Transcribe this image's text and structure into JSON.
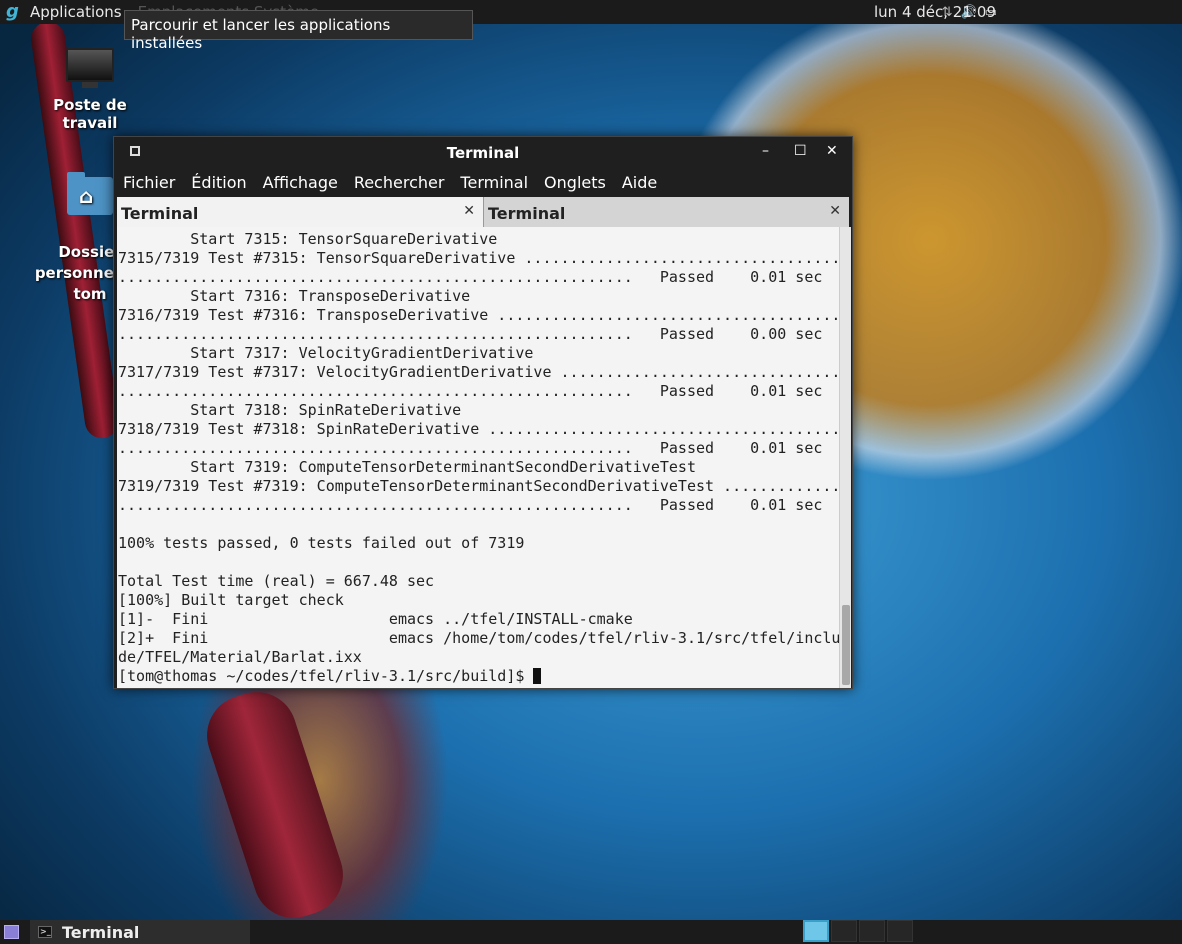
{
  "top_panel": {
    "applications_label": "Applications",
    "hidden_labels": "Emplacements  Système",
    "clock": "lun  4 déc, 21:09"
  },
  "tooltip": "Parcourir et lancer les applications installées",
  "desktop": {
    "icons": [
      {
        "label": "Poste de travail"
      },
      {
        "label": "Dossier\npersonnel de tom"
      }
    ]
  },
  "window": {
    "title": "Terminal",
    "menu": [
      "Fichier",
      "Édition",
      "Affichage",
      "Rechercher",
      "Terminal",
      "Onglets",
      "Aide"
    ],
    "tabs": [
      {
        "label": "Terminal",
        "active": true
      },
      {
        "label": "Terminal",
        "active": false
      }
    ],
    "terminal_lines": [
      "        Start 7315: TensorSquareDerivative",
      "7315/7319 Test #7315: TensorSquareDerivative ..............................................",
      ".........................................................   Passed    0.01 sec",
      "        Start 7316: TransposeDerivative",
      "7316/7319 Test #7316: TransposeDerivative ..................................................",
      ".........................................................   Passed    0.00 sec",
      "        Start 7317: VelocityGradientDerivative",
      "7317/7319 Test #7317: VelocityGradientDerivative ...........................................",
      ".........................................................   Passed    0.01 sec",
      "        Start 7318: SpinRateDerivative",
      "7318/7319 Test #7318: SpinRateDerivative ...................................................",
      ".........................................................   Passed    0.01 sec",
      "        Start 7319: ComputeTensorDeterminantSecondDerivativeTest",
      "7319/7319 Test #7319: ComputeTensorDeterminantSecondDerivativeTest ..........................",
      ".........................................................   Passed    0.01 sec",
      "",
      "100% tests passed, 0 tests failed out of 7319",
      "",
      "Total Test time (real) = 667.48 sec",
      "[100%] Built target check",
      "[1]-  Fini                    emacs ../tfel/INSTALL-cmake",
      "[2]+  Fini                    emacs /home/tom/codes/tfel/rliv-3.1/src/tfel/inclu",
      "de/TFEL/Material/Barlat.ixx"
    ],
    "prompt": "[tom@thomas ~/codes/tfel/rliv-3.1/src/build]$ "
  },
  "taskbar": {
    "task_label": "Terminal",
    "workspaces": [
      true,
      false,
      false,
      false
    ]
  }
}
